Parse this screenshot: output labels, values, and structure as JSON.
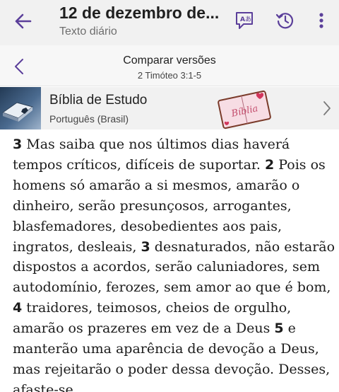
{
  "topbar": {
    "title": "12 de dezembro de...",
    "subtitle": "Texto diário",
    "icons": [
      "back-arrow-icon",
      "translate-icon",
      "history-icon",
      "more-vert-icon"
    ],
    "accent": "#5b3f9a"
  },
  "compare": {
    "title": "Comparar versões",
    "reference": "2 Timóteo 3:1-5"
  },
  "publication": {
    "name": "Bíblia de Estudo",
    "language": "Português (Brasil)",
    "sticker_text": "Bíblia"
  },
  "verses": [
    {
      "number": "3",
      "text": " Mas saiba que nos últimos dias haverá tempos críticos, difíceis de suportar. "
    },
    {
      "number": "2",
      "text": " Pois os homens só amarão a si mesmos, amarão o dinheiro, serão presunçosos, arrogantes, blasfemadores, desobedientes aos pais, ingratos, desleais, "
    },
    {
      "number": "3",
      "text": " desnaturados, não estarão dispostos a acordos, serão caluniadores, sem autodomínio, ferozes, sem amor ao que é bom, "
    },
    {
      "number": "4",
      "text": " traidores, teimosos, cheios de orgulho, amarão os prazeres em vez de a Deus "
    },
    {
      "number": "5",
      "text": " e manterão uma aparência de devoção a Deus, mas rejeitarão o poder dessa devoção. Desses, afaste-se."
    }
  ]
}
